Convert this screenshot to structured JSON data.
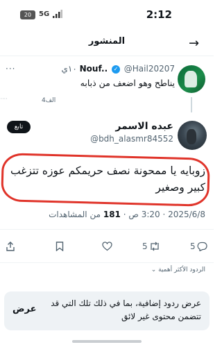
{
  "status_bar": {
    "time": "2:12",
    "battery": "20",
    "network": "5G"
  },
  "header": {
    "title": "المنشور"
  },
  "reply_tweet": {
    "display_name": "Nouf..",
    "handle": "@Hail20207",
    "time_ago": "١٠ي",
    "text": "يناطح وهو اضعف من ذبابه",
    "views": "4الف"
  },
  "main_tweet": {
    "display_name": "عبده الاسمر",
    "handle": "@bdh_alasmr84552",
    "follow_label": "تابع",
    "text": "زوبايه يا ممحونة نصف حريمكم عوزه تتزغب كبير وصغير",
    "date": "2025/6/8",
    "time": "3:20 ص",
    "views_count": "181",
    "views_label": "من المشاهدات"
  },
  "actions": {
    "replies": "5",
    "retweets": "5"
  },
  "replies_sort": "الردود الأكثر أهمية",
  "hidden_replies": {
    "text": "عرض ردود إضافية، بما في ذلك تلك التي قد تتضمن محتوى غير لائق",
    "show_label": "عرض"
  }
}
